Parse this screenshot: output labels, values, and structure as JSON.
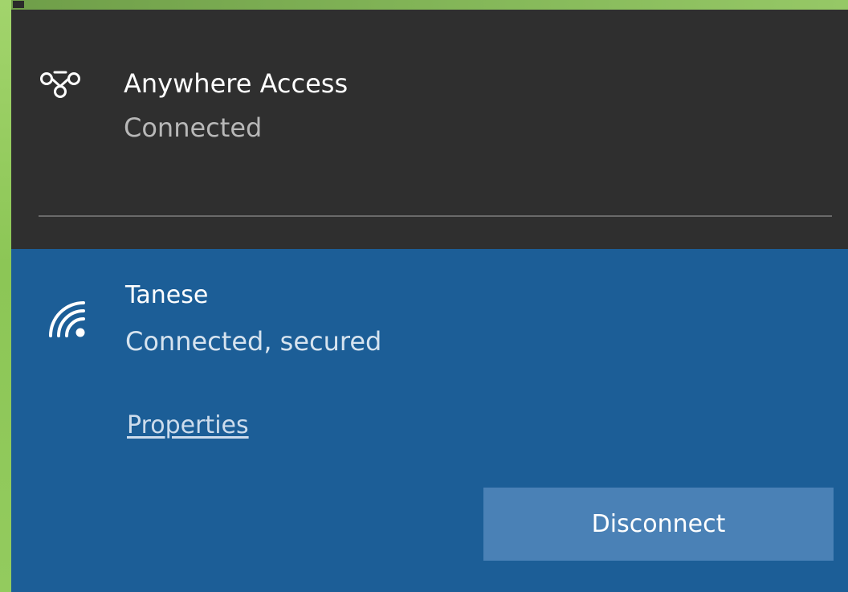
{
  "vpn": {
    "icon": "vpn-icon",
    "name": "Anywhere Access",
    "status": "Connected"
  },
  "wifi": {
    "icon": "wifi-icon",
    "name": "Tanese",
    "status": "Connected, secured",
    "properties_label": "Properties",
    "disconnect_label": "Disconnect"
  },
  "colors": {
    "background": "#8fc85a",
    "vpn_panel": "#2f2f2f",
    "wifi_panel": "#1c5e97",
    "button": "#4a81b6"
  }
}
